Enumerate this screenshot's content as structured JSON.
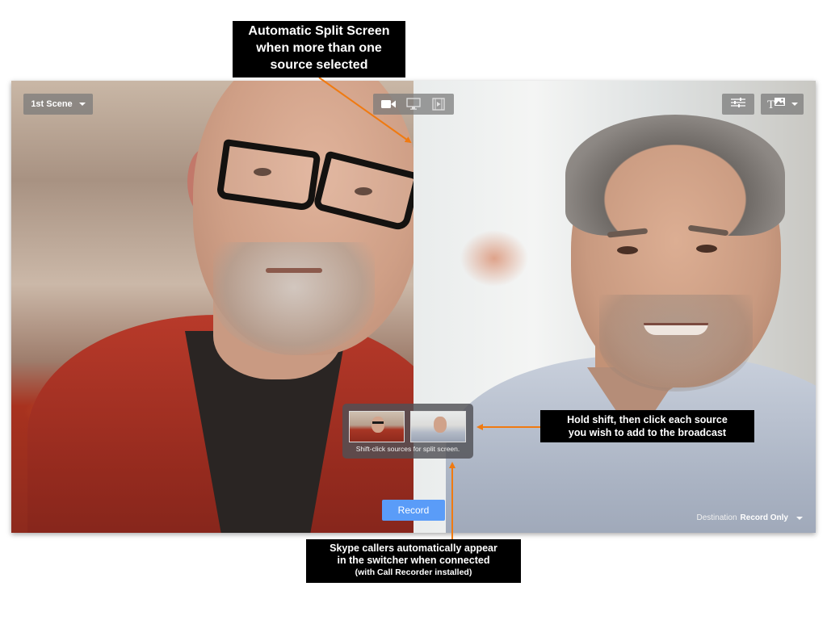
{
  "annotations": {
    "split_screen": {
      "lines": [
        "Automatic Split Screen",
        "when more than one",
        "source selected"
      ]
    },
    "shift_click": {
      "lines": [
        "Hold shift, then click each source",
        "you wish to add to the broadcast"
      ]
    },
    "skype": {
      "lines": [
        "Skype callers automatically appear",
        "in the switcher when connected"
      ],
      "note": "(with Call Recorder installed)"
    },
    "arrow_color": "#f07a10"
  },
  "toolbar": {
    "scene_selector": "1st Scene",
    "sources": [
      {
        "icon": "video-camera-icon",
        "label": "Camera"
      },
      {
        "icon": "monitor-icon",
        "label": "Screen"
      },
      {
        "icon": "film-icon",
        "label": "Media"
      }
    ],
    "settings_icon": "sliders-icon",
    "overlay_icon": "text-image-overlay-icon"
  },
  "switcher": {
    "hint": "Shift-click sources for split screen.",
    "thumbnails": [
      {
        "name": "Bald man with glasses, red sweater"
      },
      {
        "name": "Grey-haired man, light blue shirt"
      }
    ]
  },
  "record_button": "Record",
  "destination": {
    "label": "Destination",
    "value": "Record Only"
  },
  "colors": {
    "record_blue": "#5a9cf8",
    "callout_bg": "#000000"
  }
}
